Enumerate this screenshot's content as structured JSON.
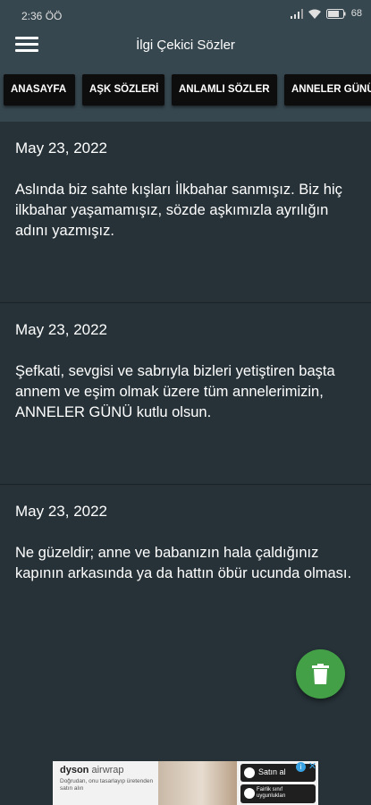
{
  "status_bar": {
    "time": "2:36 ÖÖ",
    "battery": "68"
  },
  "app_bar": {
    "title": "İlgi Çekici Sözler",
    "menu_icon": "hamburger-menu-icon"
  },
  "tabs": [
    {
      "label": "ANASAYFA"
    },
    {
      "label": "AŞK SÖZLERİ"
    },
    {
      "label": "ANLAMLI SÖZLER"
    },
    {
      "label": "ANNELER GÜNÜ"
    }
  ],
  "entries": [
    {
      "date": "May 23, 2022",
      "text": "Aslında biz sahte kışları İlkbahar sanmışız. Biz hiç ilkbahar yaşamamışız, sözde aşkımızla ayrılığın adını yazmışız."
    },
    {
      "date": "May 23, 2022",
      "text": "Şefkati, sevgisi ve sabrıyla bizleri yetiştiren başta annem ve eşim olmak üzere tüm annelerimizin, ANNELER GÜNÜ kutlu olsun."
    },
    {
      "date": "May 23, 2022",
      "text": "Ne güzeldir; anne ve babanızın hala çaldığınız kapının arkasında ya da hattın öbür ucunda olması."
    }
  ],
  "fab": {
    "icon": "trash-icon",
    "color": "#43a047"
  },
  "ad": {
    "brand": "dyson",
    "brand_sub": "airwrap",
    "description": "Doğrudan, onu tasarlayıp üretenden satın alın",
    "cta": "Satın al",
    "cta2": "Fairlik sınıf uygunlukları",
    "info": "i",
    "close": "✕"
  },
  "colors": {
    "background": "#263238",
    "app_bar": "#37474f",
    "tab_chip": "#0d0d0d",
    "fab": "#43a047"
  }
}
